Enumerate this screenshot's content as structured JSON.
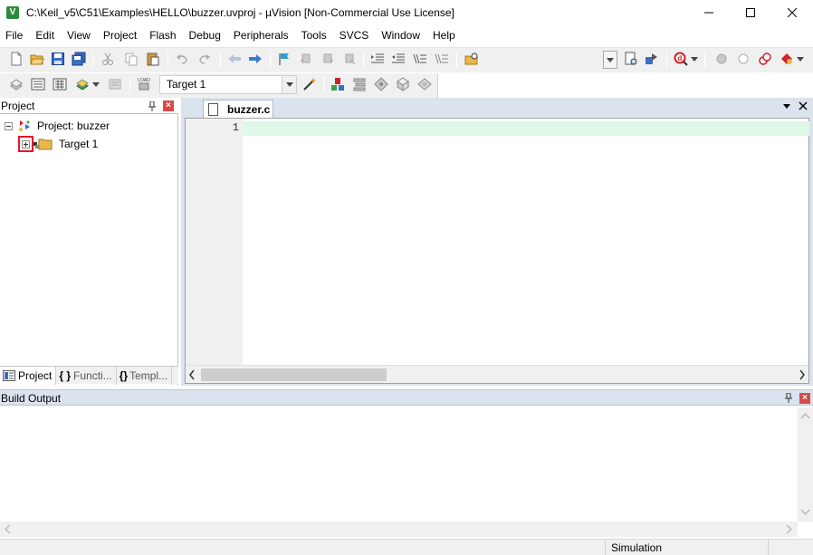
{
  "window": {
    "title": "C:\\Keil_v5\\C51\\Examples\\HELLO\\buzzer.uvproj - µVision  [Non-Commercial Use License]",
    "icon_letter": "V"
  },
  "menu": [
    "File",
    "Edit",
    "View",
    "Project",
    "Flash",
    "Debug",
    "Peripherals",
    "Tools",
    "SVCS",
    "Window",
    "Help"
  ],
  "toolbar2": {
    "target_value": "Target 1",
    "load_label": "LOAD"
  },
  "project_panel": {
    "title": "Project",
    "root_label": "Project: buzzer",
    "target_label": "Target 1",
    "tabs": [
      {
        "icon": "{}",
        "label": "Project"
      },
      {
        "icon": "{ }",
        "label": "Functi..."
      },
      {
        "icon": "{}",
        "label": "Templ..."
      }
    ]
  },
  "editor": {
    "tab_label": "buzzer.c",
    "line_numbers": [
      "1"
    ]
  },
  "build_output": {
    "title": "Build Output"
  },
  "statusbar": {
    "mode": "Simulation"
  },
  "colors": {
    "accent_red": "#e0192a",
    "current_line": "#e0f8e8",
    "dock_blue": "#dbe3ee"
  }
}
